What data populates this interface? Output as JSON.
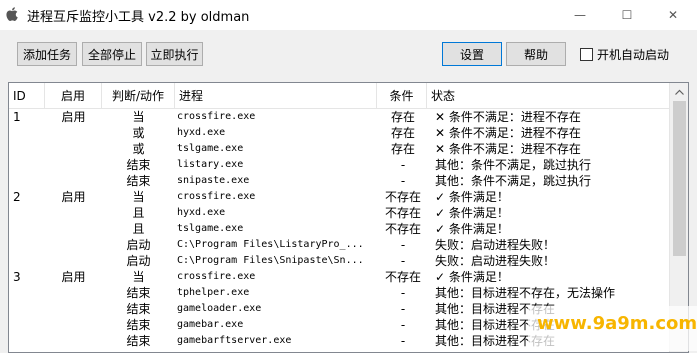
{
  "window": {
    "title": "进程互斥监控小工具 v2.2 by oldman",
    "minimize_glyph": "—",
    "maximize_glyph": "☐",
    "close_glyph": "✕"
  },
  "toolbar": {
    "add_task": "添加任务",
    "stop_all": "全部停止",
    "run_now": "立即执行",
    "settings": "设置",
    "help": "帮助",
    "autostart_label": "开机自动启动"
  },
  "table": {
    "columns": [
      "ID",
      "启用",
      "判断/动作",
      "进程",
      "条件",
      "状态"
    ],
    "rows": [
      {
        "id": "1",
        "enabled": "启用",
        "action": "当",
        "process": "crossfire.exe",
        "condition": "存在",
        "status": "✕ 条件不满足：进程不存在"
      },
      {
        "id": "",
        "enabled": "",
        "action": "或",
        "process": "hyxd.exe",
        "condition": "存在",
        "status": "✕ 条件不满足：进程不存在"
      },
      {
        "id": "",
        "enabled": "",
        "action": "或",
        "process": "tslgame.exe",
        "condition": "存在",
        "status": "✕ 条件不满足：进程不存在"
      },
      {
        "id": "",
        "enabled": "",
        "action": "结束",
        "process": "listary.exe",
        "condition": "-",
        "status": "其他：条件不满足，跳过执行"
      },
      {
        "id": "",
        "enabled": "",
        "action": "结束",
        "process": "snipaste.exe",
        "condition": "-",
        "status": "其他：条件不满足，跳过执行"
      },
      {
        "id": "2",
        "enabled": "启用",
        "action": "当",
        "process": "crossfire.exe",
        "condition": "不存在",
        "status": "✓ 条件满足！"
      },
      {
        "id": "",
        "enabled": "",
        "action": "且",
        "process": "hyxd.exe",
        "condition": "不存在",
        "status": "✓ 条件满足！"
      },
      {
        "id": "",
        "enabled": "",
        "action": "且",
        "process": "tslgame.exe",
        "condition": "不存在",
        "status": "✓ 条件满足！"
      },
      {
        "id": "",
        "enabled": "",
        "action": "启动",
        "process": "C:\\Program Files\\ListaryPro_...",
        "condition": "-",
        "status": "失败：启动进程失败！"
      },
      {
        "id": "",
        "enabled": "",
        "action": "启动",
        "process": "C:\\Program Files\\Snipaste\\Sn...",
        "condition": "-",
        "status": "失败：启动进程失败！"
      },
      {
        "id": "3",
        "enabled": "启用",
        "action": "当",
        "process": "crossfire.exe",
        "condition": "不存在",
        "status": "✓ 条件满足！"
      },
      {
        "id": "",
        "enabled": "",
        "action": "结束",
        "process": "tphelper.exe",
        "condition": "-",
        "status": "其他：目标进程不存在，无法操作"
      },
      {
        "id": "",
        "enabled": "",
        "action": "结束",
        "process": "gameloader.exe",
        "condition": "-",
        "status": "其他：目标进程不存在"
      },
      {
        "id": "",
        "enabled": "",
        "action": "结束",
        "process": "gamebar.exe",
        "condition": "-",
        "status": "其他：目标进程不存在"
      },
      {
        "id": "",
        "enabled": "",
        "action": "结束",
        "process": "gamebarftserver.exe",
        "condition": "-",
        "status": "其他：目标进程不存在"
      }
    ]
  },
  "watermark": "www.9a9m.com"
}
